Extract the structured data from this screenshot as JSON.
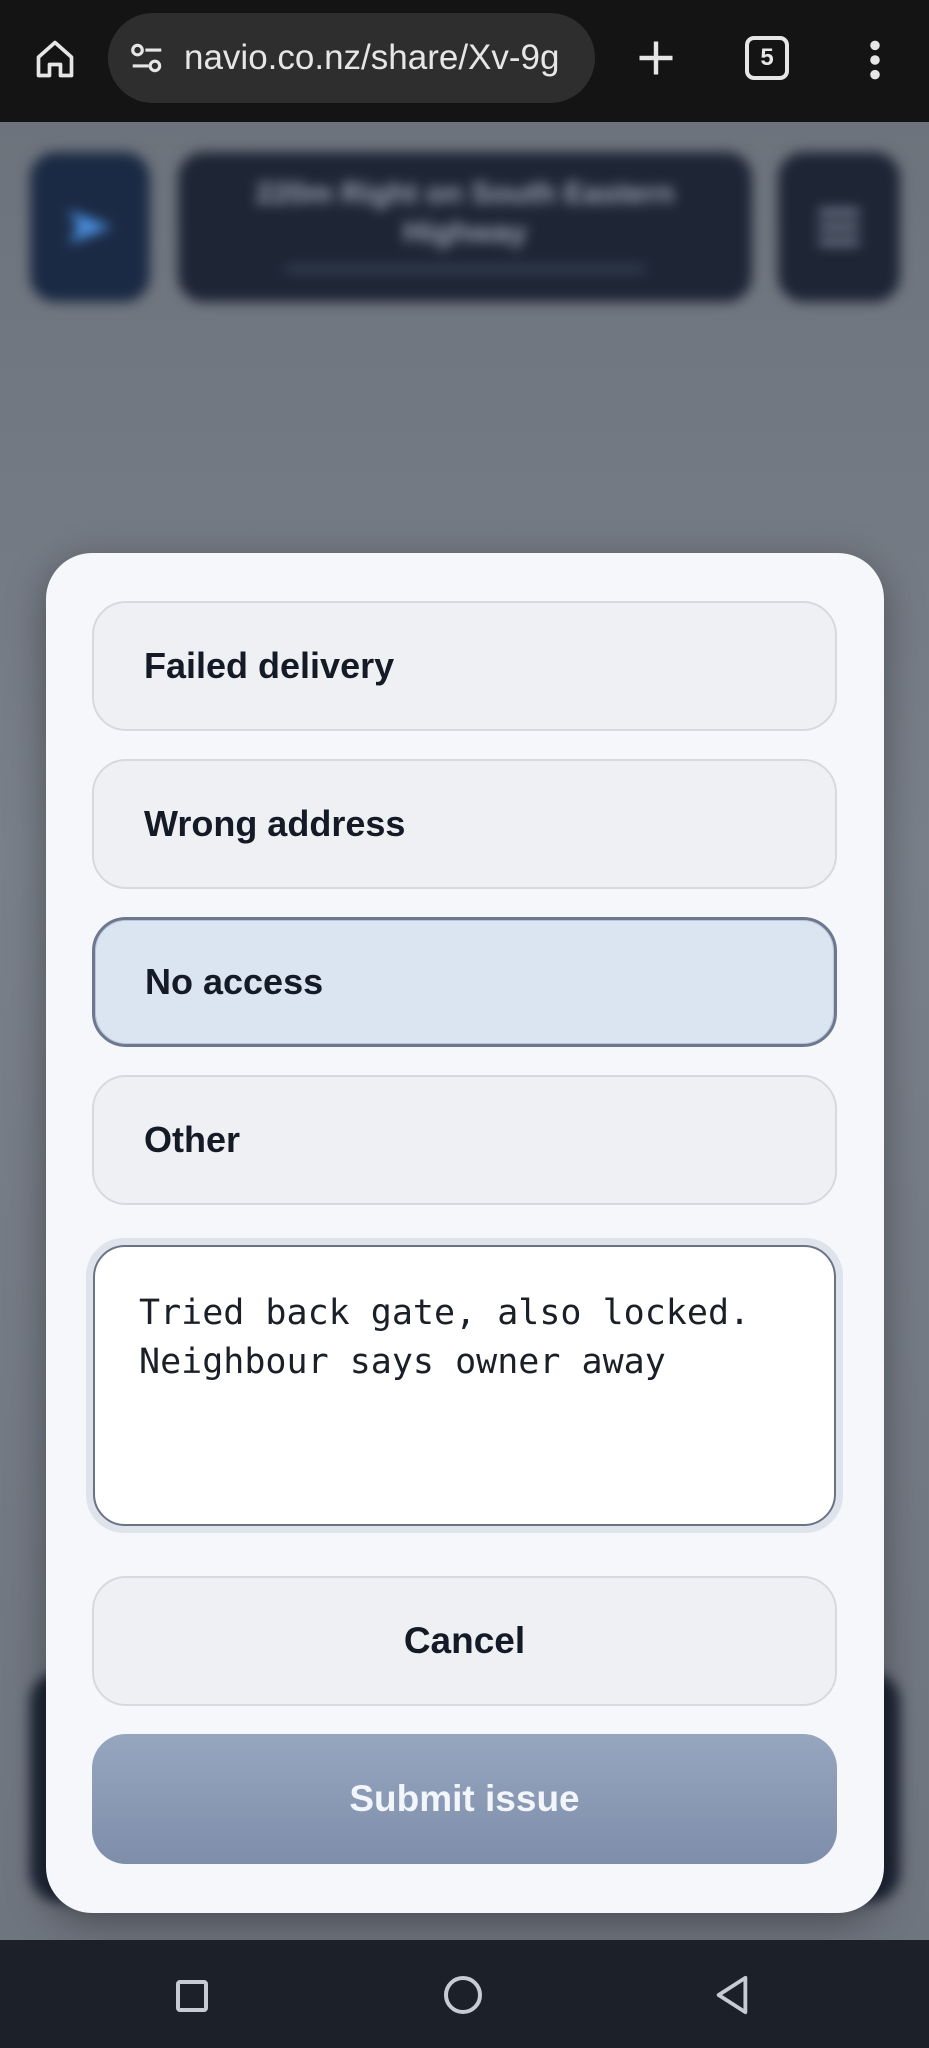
{
  "browser": {
    "url": "navio.co.nz/share/Xv-9g",
    "tab_count": "5"
  },
  "app_background": {
    "banner_text": "220m Right on South Eastern Highway"
  },
  "modal": {
    "options": [
      {
        "label": "Failed delivery",
        "selected": false
      },
      {
        "label": "Wrong address",
        "selected": false
      },
      {
        "label": "No access",
        "selected": true
      },
      {
        "label": "Other",
        "selected": false
      }
    ],
    "note_value": "Tried back gate, also locked.\nNeighbour says owner away",
    "cancel_label": "Cancel",
    "submit_label": "Submit issue"
  },
  "colors": {
    "selected_option_bg": "#dbe5f1",
    "submit_bg": "#8696b3",
    "modal_bg": "#f5f7fa"
  }
}
